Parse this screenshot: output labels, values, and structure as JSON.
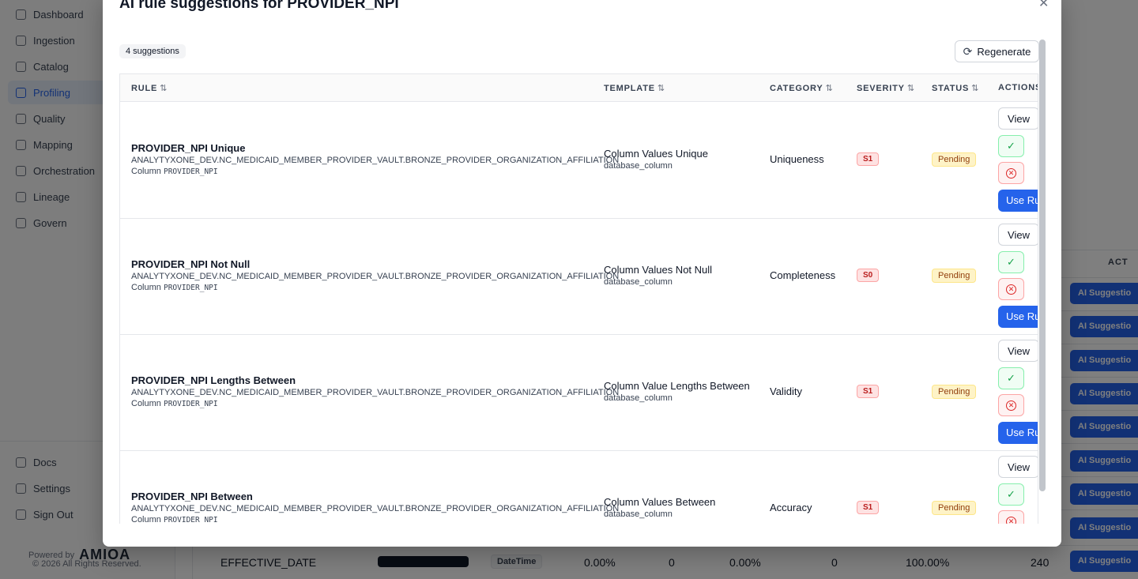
{
  "sidebar": {
    "items": [
      {
        "label": "Dashboard",
        "icon": "dashboard-icon"
      },
      {
        "label": "Ingestion",
        "icon": "ingestion-icon"
      },
      {
        "label": "Catalog",
        "icon": "catalog-icon"
      },
      {
        "label": "Profiling",
        "icon": "profiling-icon",
        "active": true
      },
      {
        "label": "Quality",
        "icon": "quality-icon"
      },
      {
        "label": "Mapping",
        "icon": "mapping-icon"
      },
      {
        "label": "Orchestration",
        "icon": "orchestration-icon"
      },
      {
        "label": "Lineage",
        "icon": "lineage-icon"
      },
      {
        "label": "Govern",
        "icon": "govern-icon"
      }
    ],
    "bottom": [
      {
        "label": "Docs",
        "icon": "docs-icon"
      },
      {
        "label": "Settings",
        "icon": "settings-icon"
      },
      {
        "label": "Sign Out",
        "icon": "sign-out-icon"
      }
    ],
    "powered_by": "Powered by",
    "logo": "AMIOA",
    "copyright": "© 2026 All Rights Reserved."
  },
  "background": {
    "actions_header": "ACT",
    "ai_button_label": "AI Suggestio",
    "last_row": {
      "name": "EFFECTIVE_DATE",
      "type": "DateTime",
      "null_pct": "0.00%",
      "nulls": "0",
      "dup_pct": "0.00%",
      "dups": "0",
      "unique_pct": "100.00%",
      "distinct": "240"
    }
  },
  "modal": {
    "title": "AI rule suggestions for PROVIDER_NPI",
    "close_icon": "close-icon",
    "count": "4 suggestions",
    "regenerate_label": "Regenerate",
    "columns": {
      "rule": "RULE",
      "template": "TEMPLATE",
      "category": "CATEGORY",
      "severity": "SEVERITY",
      "status": "STATUS",
      "actions": "ACTIONS"
    },
    "sort_glyph": "⇅",
    "column_prefix": "Column",
    "buttons": {
      "view": "View",
      "use_rule": "Use Rule"
    },
    "rows": [
      {
        "name": "PROVIDER_NPI Unique",
        "path": "ANALYTYXONE_DEV.NC_MEDICAID_MEMBER_PROVIDER_VAULT.BRONZE_PROVIDER_ORGANIZATION_AFFILIATION",
        "column": "PROVIDER_NPI",
        "template": "Column Values Unique",
        "template_type": "database_column",
        "category": "Uniqueness",
        "severity": "S1",
        "status": "Pending"
      },
      {
        "name": "PROVIDER_NPI Not Null",
        "path": "ANALYTYXONE_DEV.NC_MEDICAID_MEMBER_PROVIDER_VAULT.BRONZE_PROVIDER_ORGANIZATION_AFFILIATION",
        "column": "PROVIDER_NPI",
        "template": "Column Values Not Null",
        "template_type": "database_column",
        "category": "Completeness",
        "severity": "S0",
        "status": "Pending"
      },
      {
        "name": "PROVIDER_NPI Lengths Between",
        "path": "ANALYTYXONE_DEV.NC_MEDICAID_MEMBER_PROVIDER_VAULT.BRONZE_PROVIDER_ORGANIZATION_AFFILIATION",
        "column": "PROVIDER_NPI",
        "template": "Column Value Lengths Between",
        "template_type": "database_column",
        "category": "Validity",
        "severity": "S1",
        "status": "Pending"
      },
      {
        "name": "PROVIDER_NPI Between",
        "path": "ANALYTYXONE_DEV.NC_MEDICAID_MEMBER_PROVIDER_VAULT.BRONZE_PROVIDER_ORGANIZATION_AFFILIATION",
        "column": "PROVIDER_NPI",
        "template": "Column Values Between",
        "template_type": "database_column",
        "category": "Accuracy",
        "severity": "S1",
        "status": "Pending"
      }
    ]
  },
  "colors": {
    "primary": "#2563eb",
    "severity_bg": "#fee2e2",
    "status_bg": "#fef3c7",
    "accept": "#16a34a",
    "reject": "#dc2626"
  }
}
